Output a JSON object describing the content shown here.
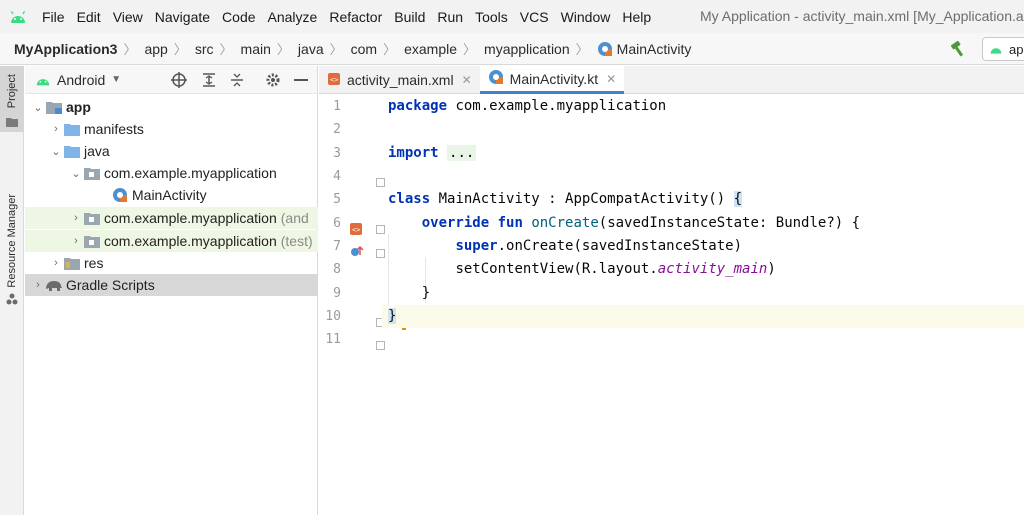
{
  "menubar": {
    "items": [
      "File",
      "Edit",
      "View",
      "Navigate",
      "Code",
      "Analyze",
      "Refactor",
      "Build",
      "Run",
      "Tools",
      "VCS",
      "Window",
      "Help"
    ],
    "title": "My Application - activity_main.xml [My_Application.a"
  },
  "navbar": {
    "crumbs": [
      "MyApplication3",
      "app",
      "src",
      "main",
      "java",
      "com",
      "example",
      "myapplication",
      "MainActivity"
    ],
    "run_config": "ap"
  },
  "leftstripe": {
    "project": "Project",
    "resource_manager": "Resource Manager"
  },
  "project_panel": {
    "view_label": "Android",
    "tree": [
      {
        "label": "app",
        "suffix": ""
      },
      {
        "label": "manifests",
        "suffix": ""
      },
      {
        "label": "java",
        "suffix": ""
      },
      {
        "label": "com.example.myapplication",
        "suffix": ""
      },
      {
        "label": "MainActivity",
        "suffix": ""
      },
      {
        "label": "com.example.myapplication",
        "suffix": "(and"
      },
      {
        "label": "com.example.myapplication",
        "suffix": "(test)"
      },
      {
        "label": "res",
        "suffix": ""
      },
      {
        "label": "Gradle Scripts",
        "suffix": ""
      }
    ]
  },
  "editor": {
    "tabs": [
      {
        "label": "activity_main.xml"
      },
      {
        "label": "MainActivity.kt"
      }
    ],
    "line_numbers": [
      "1",
      "2",
      "3",
      "4",
      "5",
      "6",
      "7",
      "8",
      "9",
      "10",
      "11"
    ],
    "code": {
      "l1_kw": "package",
      "l1_rest": " com.example.myapplication",
      "l3_kw": "import",
      "l3_fold": "...",
      "l6_kw": "class",
      "l6_rest": " MainActivity : AppCompatActivity() ",
      "l6_brace": "{",
      "l7_indent": "    ",
      "l7_kw1": "override",
      "l7_kw2": "fun",
      "l7_fn": "onCreate",
      "l7_rest": "(savedInstanceState: Bundle?) {",
      "l8_indent": "        ",
      "l8_kw": "super",
      "l8_rest": ".onCreate(savedInstanceState)",
      "l9_indent": "        ",
      "l9_fn": "setContentView",
      "l9_mid": "(R.layout.",
      "l9_ital": "activity_main",
      "l9_end": ")",
      "l10_text": "    }",
      "l11_brace": "}"
    }
  },
  "colors": {
    "keyword": "#0033b3",
    "function": "#00627a",
    "italic_ref": "#871094",
    "tab_underline": "#4083c9",
    "android_green": "#3ddc84"
  }
}
